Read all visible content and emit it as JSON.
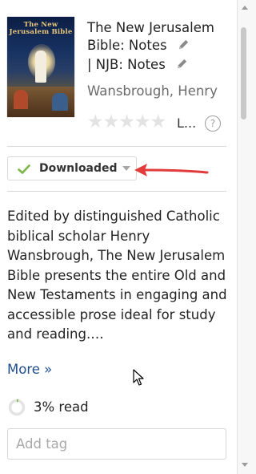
{
  "book": {
    "cover_title": "The New Jerusalem Bible",
    "title_line1": "The New Jerusalem",
    "title_line2": "Bible: Notes",
    "title_line3": "| NJB: Notes",
    "author": "Wansbrough, Henry",
    "rating_stars": 0,
    "rating_label": "L...",
    "help_icon_text": "?"
  },
  "status": {
    "label": "Downloaded",
    "accent_color": "#7ab648"
  },
  "annotation": {
    "arrow_color": "#e23b3b"
  },
  "description": {
    "text": "Edited by distinguished Catholic biblical scholar Henry Wansbrough, The New Jerusalem Bible presents the entire Old and New Testaments in engaging and accessible prose ideal for study and reading.…"
  },
  "more_link": "More »",
  "progress": {
    "fraction": 0.03,
    "label": "3% read"
  },
  "tags": {
    "placeholder": "Add tag",
    "value": ""
  },
  "colors": {
    "link": "#1f4e8c",
    "star_empty": "#e3e3e3"
  }
}
